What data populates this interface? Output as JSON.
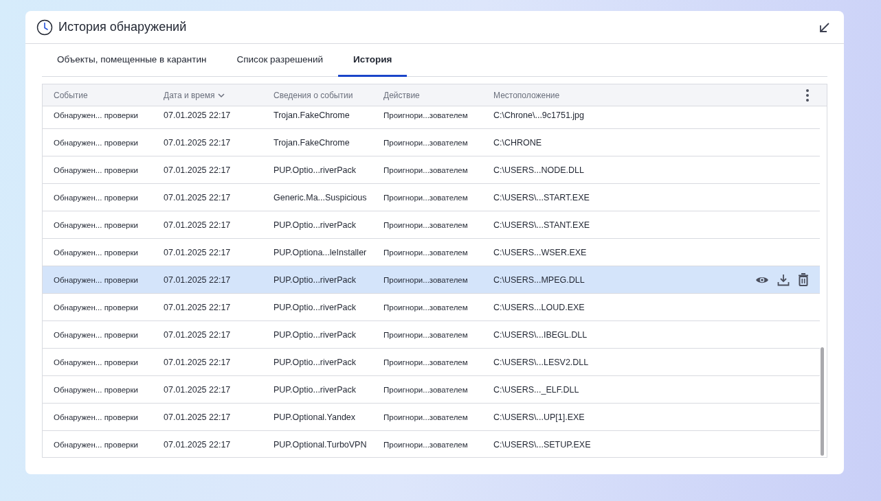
{
  "window": {
    "title": "История обнаружений"
  },
  "tabs": [
    {
      "label": "Объекты, помещенные в карантин",
      "selected": false
    },
    {
      "label": "Список разрешений",
      "selected": false
    },
    {
      "label": "История",
      "selected": true
    }
  ],
  "table": {
    "columns": [
      {
        "label": "Событие",
        "sorted": false
      },
      {
        "label": "Дата и время",
        "sorted": true
      },
      {
        "label": "Сведения о событии",
        "sorted": false
      },
      {
        "label": "Действие",
        "sorted": false
      },
      {
        "label": "Местоположение",
        "sorted": false
      }
    ],
    "rows": [
      {
        "cells": [
          "Обнаружен... проверки",
          "07.01.2025 22:17",
          "Trojan.FakeChrome",
          "Проигнори...зователем",
          "C:\\Chrone\\...9c1751.jpg"
        ],
        "selected": false
      },
      {
        "cells": [
          "Обнаружен... проверки",
          "07.01.2025 22:17",
          "Trojan.FakeChrome",
          "Проигнори...зователем",
          "C:\\CHRONE"
        ],
        "selected": false
      },
      {
        "cells": [
          "Обнаружен... проверки",
          "07.01.2025 22:17",
          "PUP.Optio...riverPack",
          "Проигнори...зователем",
          "C:\\USERS...NODE.DLL"
        ],
        "selected": false
      },
      {
        "cells": [
          "Обнаружен... проверки",
          "07.01.2025 22:17",
          "Generic.Ma...Suspicious",
          "Проигнори...зователем",
          "C:\\USERS\\...START.EXE"
        ],
        "selected": false
      },
      {
        "cells": [
          "Обнаружен... проверки",
          "07.01.2025 22:17",
          "PUP.Optio...riverPack",
          "Проигнори...зователем",
          "C:\\USERS\\...STANT.EXE"
        ],
        "selected": false
      },
      {
        "cells": [
          "Обнаружен... проверки",
          "07.01.2025 22:17",
          "PUP.Optiona...leInstaller",
          "Проигнори...зователем",
          "C:\\USERS...WSER.EXE"
        ],
        "selected": false
      },
      {
        "cells": [
          "Обнаружен... проверки",
          "07.01.2025 22:17",
          "PUP.Optio...riverPack",
          "Проигнори...зователем",
          "C:\\USERS...MPEG.DLL"
        ],
        "selected": true
      },
      {
        "cells": [
          "Обнаружен... проверки",
          "07.01.2025 22:17",
          "PUP.Optio...riverPack",
          "Проигнори...зователем",
          "C:\\USERS...LOUD.EXE"
        ],
        "selected": false
      },
      {
        "cells": [
          "Обнаружен... проверки",
          "07.01.2025 22:17",
          "PUP.Optio...riverPack",
          "Проигнори...зователем",
          "C:\\USERS\\...IBEGL.DLL"
        ],
        "selected": false
      },
      {
        "cells": [
          "Обнаружен... проверки",
          "07.01.2025 22:17",
          "PUP.Optio...riverPack",
          "Проигнори...зователем",
          "C:\\USERS\\...LESV2.DLL"
        ],
        "selected": false
      },
      {
        "cells": [
          "Обнаружен... проверки",
          "07.01.2025 22:17",
          "PUP.Optio...riverPack",
          "Проигнори...зователем",
          "C:\\USERS..._ELF.DLL"
        ],
        "selected": false
      },
      {
        "cells": [
          "Обнаружен... проверки",
          "07.01.2025 22:17",
          "PUP.Optional.Yandex",
          "Проигнори...зователем",
          "C:\\USERS\\...UP[1].EXE"
        ],
        "selected": false
      },
      {
        "cells": [
          "Обнаружен... проверки",
          "07.01.2025 22:17",
          "PUP.Optional.TurboVPN",
          "Проигнори...зователем",
          "C:\\USERS\\...SETUP.EXE"
        ],
        "selected": false
      }
    ]
  }
}
